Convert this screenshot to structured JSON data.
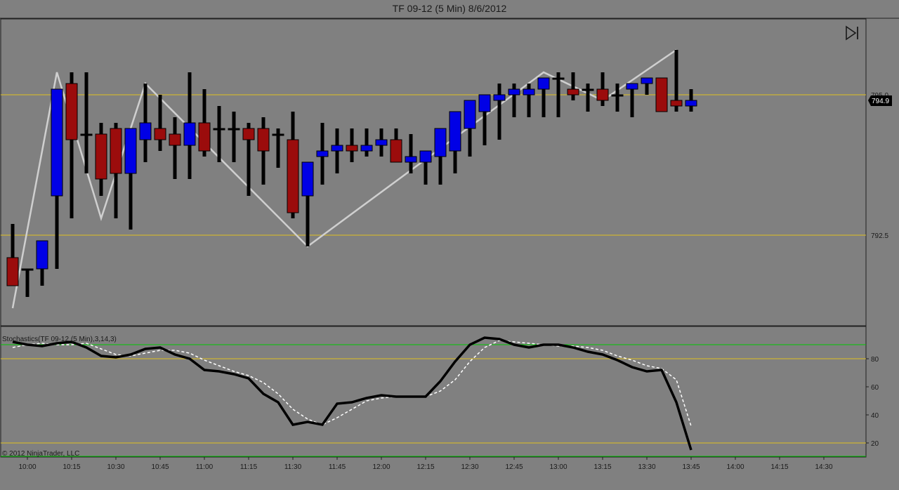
{
  "title": "TF 09-12 (5 Min)  8/6/2012",
  "copyright": "© 2012 NinjaTrader, LLC",
  "last_price_label": "794.9",
  "indicator_label": "Stochastics(TF 09-12 (5 Min),3,14,3)",
  "colors": {
    "background": "#808080",
    "up_bar": "#0000e6",
    "down_bar": "#9b0c0c",
    "wick": "#000000",
    "zigzag": "#cfcfcf",
    "hline": "#e0c020",
    "stoch_upper": "#00c800",
    "stoch_k": "#000000",
    "stoch_d": "#ffffff"
  },
  "chart_data": [
    {
      "type": "candlestick",
      "title": "TF 09-12 (5 Min)  8/6/2012",
      "x": [
        "09:55",
        "10:00",
        "10:05",
        "10:10",
        "10:15",
        "10:20",
        "10:25",
        "10:30",
        "10:35",
        "10:40",
        "10:45",
        "10:50",
        "10:55",
        "11:00",
        "11:05",
        "11:10",
        "11:15",
        "11:20",
        "11:25",
        "11:30",
        "11:35",
        "11:40",
        "11:45",
        "11:50",
        "11:55",
        "12:00",
        "12:05",
        "12:10",
        "12:15",
        "12:20",
        "12:25",
        "12:30",
        "12:35",
        "12:40",
        "12:45",
        "12:50",
        "12:55",
        "13:00",
        "13:05",
        "13:10",
        "13:15",
        "13:20",
        "13:25",
        "13:30",
        "13:35",
        "13:40",
        "13:45"
      ],
      "open": [
        792.1,
        791.9,
        791.9,
        793.2,
        795.2,
        794.3,
        794.3,
        794.4,
        793.6,
        794.2,
        794.4,
        794.3,
        794.1,
        794.5,
        794.4,
        794.4,
        794.4,
        794.4,
        794.3,
        794.2,
        793.2,
        793.9,
        794.0,
        794.1,
        794.0,
        794.1,
        794.2,
        793.8,
        793.8,
        793.9,
        794.0,
        794.4,
        794.7,
        794.9,
        795.0,
        795.0,
        795.1,
        795.3,
        795.1,
        795.1,
        795.1,
        795.0,
        795.1,
        795.2,
        795.3,
        794.9,
        794.8
      ],
      "high": [
        792.7,
        791.9,
        792.4,
        793.4,
        795.4,
        795.4,
        794.5,
        794.5,
        793.9,
        795.2,
        795.0,
        794.6,
        795.4,
        795.1,
        794.8,
        794.7,
        794.5,
        794.6,
        794.4,
        794.7,
        793.3,
        794.5,
        794.4,
        794.4,
        794.4,
        794.4,
        794.4,
        794.3,
        793.9,
        794.1,
        794.3,
        794.7,
        795.0,
        795.2,
        795.2,
        795.2,
        795.1,
        795.4,
        795.4,
        795.2,
        795.4,
        795.2,
        795.2,
        795.3,
        795.3,
        795.8,
        795.1
      ],
      "low": [
        791.6,
        791.4,
        791.6,
        791.9,
        792.8,
        793.6,
        793.2,
        792.8,
        792.6,
        793.8,
        794.0,
        793.5,
        793.5,
        793.9,
        793.8,
        793.8,
        793.2,
        793.4,
        793.7,
        792.8,
        792.3,
        793.4,
        793.6,
        793.8,
        793.9,
        793.9,
        793.9,
        793.6,
        793.4,
        793.4,
        793.6,
        793.9,
        794.1,
        794.2,
        794.6,
        794.6,
        794.6,
        794.6,
        794.9,
        794.7,
        794.8,
        794.7,
        794.6,
        795.0,
        795.0,
        794.7,
        794.7
      ],
      "close": [
        791.6,
        791.9,
        792.4,
        795.1,
        794.2,
        794.3,
        793.5,
        793.6,
        794.4,
        794.5,
        794.2,
        794.1,
        794.5,
        794.0,
        794.4,
        794.4,
        794.2,
        794.0,
        794.3,
        792.9,
        793.8,
        794.0,
        794.1,
        794.0,
        794.1,
        794.2,
        793.8,
        793.9,
        794.0,
        794.4,
        794.7,
        794.9,
        795.0,
        795.0,
        795.1,
        795.1,
        795.3,
        795.3,
        795.0,
        795.1,
        794.9,
        795.0,
        795.2,
        795.3,
        794.7,
        794.8,
        794.9
      ]
    },
    {
      "type": "line",
      "title": "Stochastics(TF 09-12 (5 Min),3,14,3)",
      "x": [
        "09:55",
        "10:00",
        "10:05",
        "10:10",
        "10:15",
        "10:20",
        "10:25",
        "10:30",
        "10:35",
        "10:40",
        "10:45",
        "10:50",
        "10:55",
        "11:00",
        "11:05",
        "11:10",
        "11:15",
        "11:20",
        "11:25",
        "11:30",
        "11:35",
        "11:40",
        "11:45",
        "11:50",
        "11:55",
        "12:00",
        "12:05",
        "12:10",
        "12:15",
        "12:20",
        "12:25",
        "12:30",
        "12:35",
        "12:40",
        "12:45",
        "12:50",
        "12:55",
        "13:00",
        "13:05",
        "13:10",
        "13:15",
        "13:20",
        "13:25",
        "13:30",
        "13:35",
        "13:40",
        "13:45"
      ],
      "series": [
        {
          "values": [
            92,
            90,
            89,
            91,
            92,
            88,
            82,
            81,
            83,
            87,
            88,
            83,
            80,
            72,
            71,
            69,
            66,
            55,
            49,
            33,
            35,
            33,
            48,
            49,
            52,
            54,
            53,
            53,
            53,
            64,
            78,
            90,
            95,
            94,
            90,
            88,
            90,
            90,
            88,
            85,
            83,
            79,
            74,
            71,
            72,
            49,
            15
          ]
        },
        {
          "values": [
            88,
            90,
            91,
            90,
            90,
            91,
            87,
            83,
            82,
            84,
            86,
            86,
            84,
            79,
            75,
            71,
            68,
            63,
            55,
            44,
            37,
            33,
            38,
            44,
            50,
            52,
            53,
            53,
            53,
            57,
            65,
            78,
            88,
            93,
            92,
            91,
            90,
            89,
            89,
            88,
            86,
            82,
            79,
            75,
            73,
            65,
            32
          ]
        }
      ],
      "yticks": [
        20,
        40,
        60,
        80
      ],
      "ylim": [
        10,
        100
      ]
    }
  ],
  "axes": {
    "price_ticks": [
      "795.0",
      "792.5"
    ],
    "time_ticks": [
      "10:00",
      "10:15",
      "10:30",
      "10:45",
      "11:00",
      "11:15",
      "11:30",
      "11:45",
      "12:00",
      "12:15",
      "12:30",
      "12:45",
      "13:00",
      "13:15",
      "13:30",
      "13:45",
      "14:00",
      "14:15",
      "14:30"
    ],
    "stoch_ticks": [
      "20",
      "40",
      "60",
      "80"
    ]
  }
}
